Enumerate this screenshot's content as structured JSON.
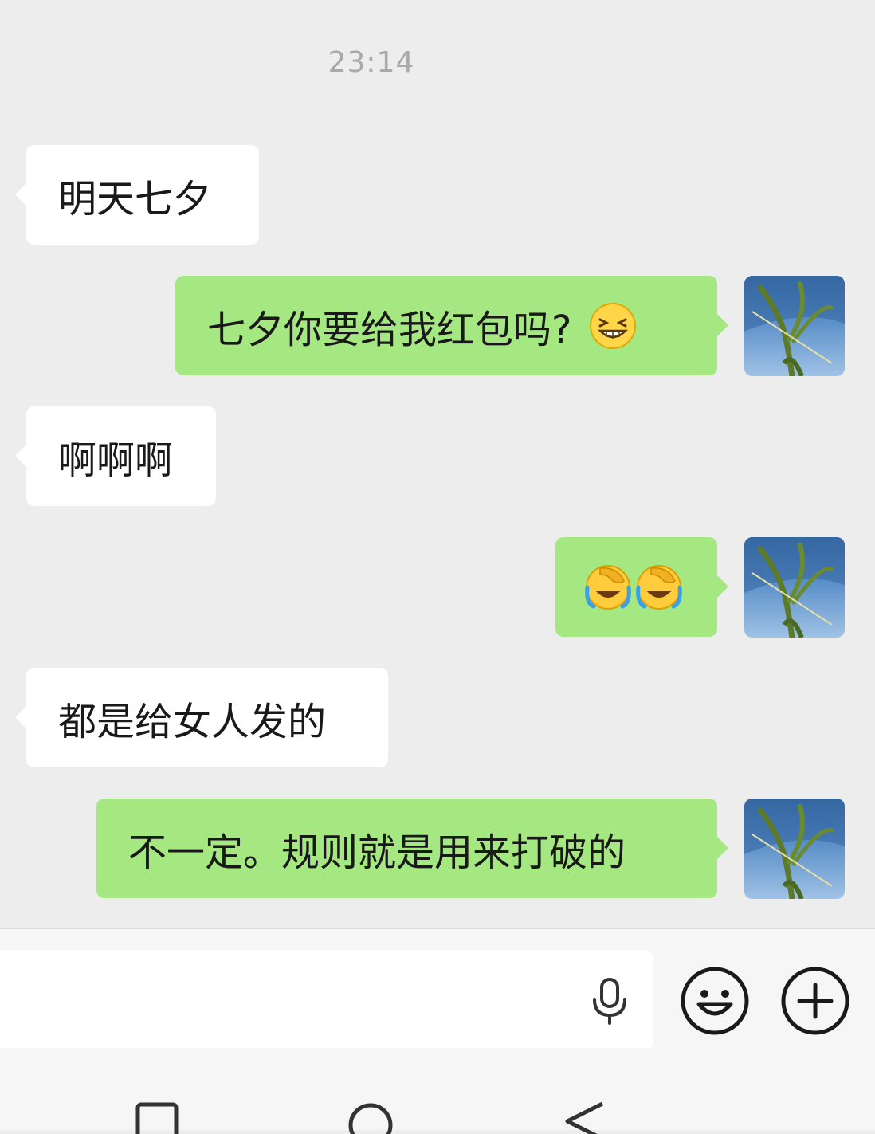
{
  "chat": {
    "timestamp": "23:14",
    "messages": [
      {
        "direction": "incoming",
        "text": "明天七夕"
      },
      {
        "direction": "outgoing",
        "text": "七夕你要给我红包吗?",
        "emoji": [
          "grinning-squint-emoji"
        ]
      },
      {
        "direction": "incoming",
        "text": "啊啊啊"
      },
      {
        "direction": "outgoing",
        "text": "",
        "emoji": [
          "facepalm-laugh-cry-emoji",
          "facepalm-laugh-cry-emoji"
        ]
      },
      {
        "direction": "incoming",
        "text": "都是给女人发的"
      },
      {
        "direction": "outgoing",
        "text": "不一定。规则就是用来打破的"
      }
    ]
  },
  "input_bar": {
    "placeholder": "",
    "icons": [
      "microphone-icon",
      "emoji-button-icon",
      "plus-button-icon"
    ]
  },
  "navbar": {
    "icons": [
      "recent-apps-square-icon",
      "home-circle-icon",
      "back-triangle-icon"
    ]
  },
  "colors": {
    "background": "#ededed",
    "incoming_bubble": "#ffffff",
    "outgoing_bubble": "#a5e882",
    "timestamp_text": "#a9a9a9"
  }
}
